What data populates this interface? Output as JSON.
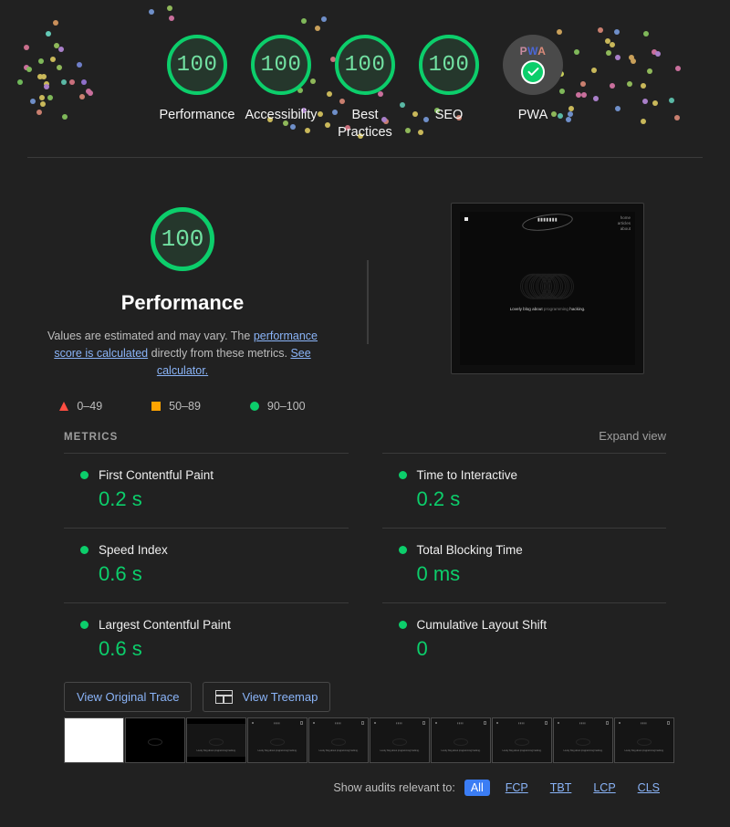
{
  "theme": {
    "background": "#212121",
    "pass_green": "#0cce6b",
    "average_orange": "#ffa400",
    "fail_red": "#ff4e42",
    "link_blue": "#8ab4f8",
    "active_pill_blue": "#3b7df4"
  },
  "top_gauges": [
    {
      "score": "100",
      "label": "Performance"
    },
    {
      "score": "100",
      "label": "Accessibility"
    },
    {
      "score": "100",
      "label": "Best Practices"
    },
    {
      "score": "100",
      "label": "SEO"
    }
  ],
  "pwa": {
    "word_p": "P",
    "word_w": "W",
    "word_a": "A",
    "label": "PWA",
    "icon": "check-circle-icon"
  },
  "performance": {
    "score": "100",
    "title": "Performance",
    "description_part1": "Values are estimated and may vary. The ",
    "link1": "performance score is calculated",
    "description_part2": " directly from these metrics. ",
    "link2": "See calculator.",
    "legend": [
      {
        "icon": "triangle-icon",
        "range": "0–49",
        "color": "#ff4e42"
      },
      {
        "icon": "square-icon",
        "range": "50–89",
        "color": "#ffa400"
      },
      {
        "icon": "circle-icon",
        "range": "90–100",
        "color": "#0cce6b"
      }
    ]
  },
  "page_screenshot": {
    "nav": [
      "home",
      "articles",
      "about"
    ],
    "tagline_a": "Lovely blog about ",
    "tagline_b": "programming",
    "tagline_c": " hacking."
  },
  "metrics": {
    "heading": "METRICS",
    "expand_label": "Expand view",
    "items": [
      {
        "name": "First Contentful Paint",
        "value": "0.2 s",
        "status": "pass"
      },
      {
        "name": "Time to Interactive",
        "value": "0.2 s",
        "status": "pass"
      },
      {
        "name": "Speed Index",
        "value": "0.6 s",
        "status": "pass"
      },
      {
        "name": "Total Blocking Time",
        "value": "0 ms",
        "status": "pass"
      },
      {
        "name": "Largest Contentful Paint",
        "value": "0.6 s",
        "status": "pass"
      },
      {
        "name": "Cumulative Layout Shift",
        "value": "0",
        "status": "pass"
      }
    ]
  },
  "buttons": {
    "view_original_trace": "View Original Trace",
    "view_treemap": "View Treemap",
    "treemap_icon": "treemap-icon"
  },
  "filmstrip": {
    "frames": [
      "blank-white",
      "dark-partial",
      "dark-partial-2",
      "loaded",
      "loaded",
      "loaded",
      "loaded",
      "loaded",
      "loaded",
      "loaded"
    ]
  },
  "audit_filters": {
    "label": "Show audits relevant to:",
    "options": [
      {
        "label": "All",
        "active": true
      },
      {
        "label": "FCP",
        "active": false
      },
      {
        "label": "TBT",
        "active": false
      },
      {
        "label": "LCP",
        "active": false
      },
      {
        "label": "CLS",
        "active": false
      }
    ]
  }
}
